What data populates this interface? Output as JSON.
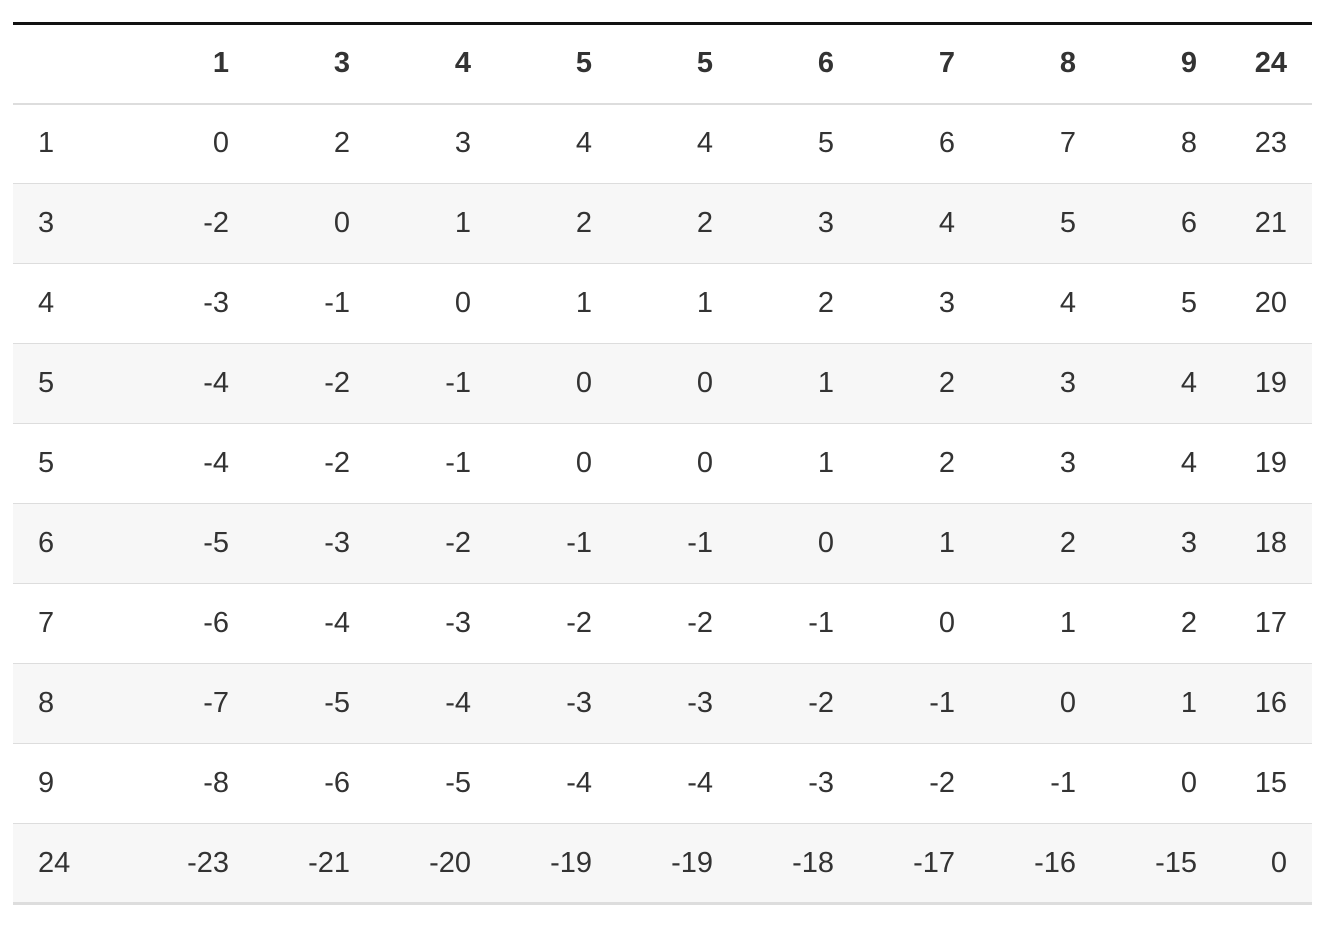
{
  "table": {
    "corner": "",
    "columns": [
      "1",
      "3",
      "4",
      "5",
      "5",
      "6",
      "7",
      "8",
      "9",
      "24"
    ],
    "rows": [
      {
        "label": "1",
        "cells": [
          "0",
          "2",
          "3",
          "4",
          "4",
          "5",
          "6",
          "7",
          "8",
          "23"
        ]
      },
      {
        "label": "3",
        "cells": [
          "-2",
          "0",
          "1",
          "2",
          "2",
          "3",
          "4",
          "5",
          "6",
          "21"
        ]
      },
      {
        "label": "4",
        "cells": [
          "-3",
          "-1",
          "0",
          "1",
          "1",
          "2",
          "3",
          "4",
          "5",
          "20"
        ]
      },
      {
        "label": "5",
        "cells": [
          "-4",
          "-2",
          "-1",
          "0",
          "0",
          "1",
          "2",
          "3",
          "4",
          "19"
        ]
      },
      {
        "label": "5",
        "cells": [
          "-4",
          "-2",
          "-1",
          "0",
          "0",
          "1",
          "2",
          "3",
          "4",
          "19"
        ]
      },
      {
        "label": "6",
        "cells": [
          "-5",
          "-3",
          "-2",
          "-1",
          "-1",
          "0",
          "1",
          "2",
          "3",
          "18"
        ]
      },
      {
        "label": "7",
        "cells": [
          "-6",
          "-4",
          "-3",
          "-2",
          "-2",
          "-1",
          "0",
          "1",
          "2",
          "17"
        ]
      },
      {
        "label": "8",
        "cells": [
          "-7",
          "-5",
          "-4",
          "-3",
          "-3",
          "-2",
          "-1",
          "0",
          "1",
          "16"
        ]
      },
      {
        "label": "9",
        "cells": [
          "-8",
          "-6",
          "-5",
          "-4",
          "-4",
          "-3",
          "-2",
          "-1",
          "0",
          "15"
        ]
      },
      {
        "label": "24",
        "cells": [
          "-23",
          "-21",
          "-20",
          "-19",
          "-19",
          "-18",
          "-17",
          "-16",
          "-15",
          "0"
        ]
      }
    ]
  },
  "colors": {
    "text": "#333333",
    "header_rule": "#111111",
    "row_rule": "#dddddd",
    "stripe": "#f7f7f7"
  }
}
